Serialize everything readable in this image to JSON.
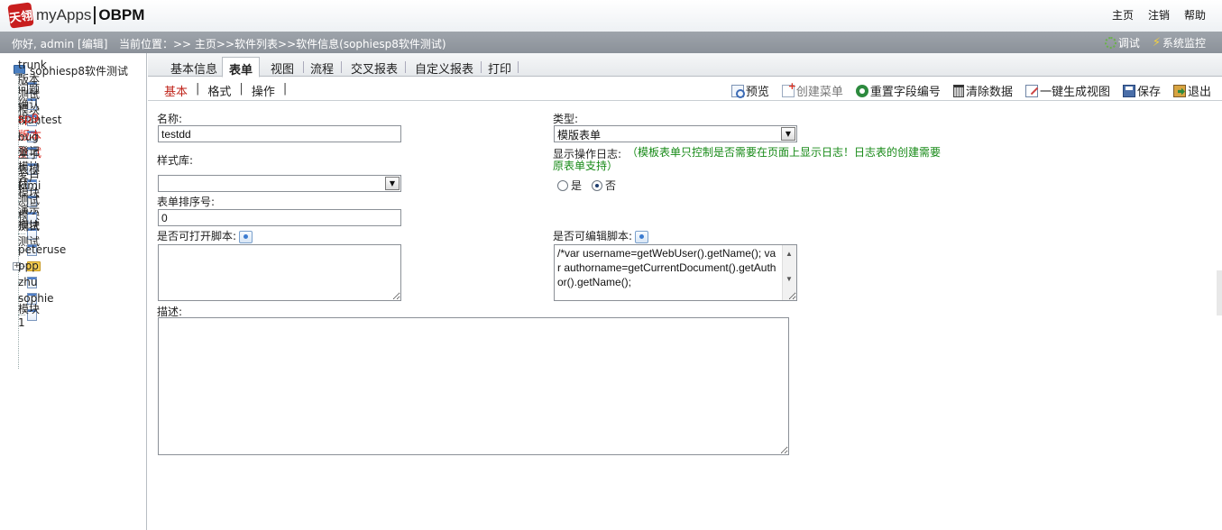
{
  "header": {
    "logo_mark": "天翎",
    "logo_app": "myApps",
    "logo_product": "OBPM",
    "links": [
      "主页",
      "注销",
      "帮助"
    ]
  },
  "status": {
    "greeting": "你好, admin [编辑]",
    "breadcrumb": "当前位置：>> 主页>>软件列表>>软件信息(sophiesp8软件测试)",
    "debug_label": "调试",
    "monitor_label": "系统监控"
  },
  "tree": {
    "root": "sophiesp8软件测试",
    "items": [
      "trunk版本测试模块",
      "问题确认模块",
      "ivantest",
      "sp9版本测试",
      "bug登记模块",
      "主子表模块",
      "客户模块",
      "kimi测试模块",
      "演示模块",
      "测试测试",
      "peteruse",
      "ppp",
      "zhu",
      "sophie",
      "模块1"
    ],
    "active_index": 3,
    "folder_index": 11
  },
  "tabs": [
    "基本信息",
    "表单",
    "视图",
    "流程",
    "交叉报表",
    "自定义报表",
    "打印"
  ],
  "selected_tab": 1,
  "subtabs": [
    "基本",
    "格式",
    "操作"
  ],
  "toolbar": {
    "preview": "预览",
    "create_menu": "创建菜单",
    "reset_fields": "重置字段编号",
    "clear_data": "清除数据",
    "gen_view": "一键生成视图",
    "save": "保存",
    "exit": "退出"
  },
  "form": {
    "name_label": "名称:",
    "name_value": "testdd",
    "type_label": "类型:",
    "type_value": "模版表单",
    "style_label": "样式库:",
    "style_value": "",
    "log_label": "显示操作日志:",
    "log_note": "（模板表单只控制是否需要在页面上显示日志！日志表的创建需要原表单支持）",
    "radio_yes": "是",
    "radio_no": "否",
    "order_label": "表单排序号:",
    "order_value": "0",
    "open_script_label": "是否可打开脚本:",
    "edit_script_label": "是否可编辑脚本:",
    "edit_script_value": "/*var username=getWebUser().getName(); var authorname=getCurrentDocument().getAuthor().getName();",
    "desc_label": "描述:"
  }
}
